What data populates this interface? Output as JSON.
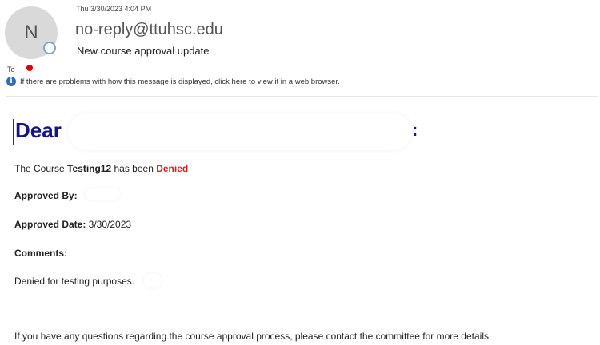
{
  "header": {
    "avatar_initial": "N",
    "timestamp": "Thu 3/30/2023 4:04 PM",
    "sender": "no-reply@ttuhsc.edu",
    "subject": "New course approval update",
    "to_label": "To",
    "info_text": "If there are problems with how this message is displayed, click here to view it in a web browser."
  },
  "body": {
    "greeting": "Dear",
    "greeting_colon": ":",
    "course_prefix": "The Course ",
    "course_name": "Testing12",
    "course_middle": " has been ",
    "course_status": "Denied",
    "approved_by_label": "Approved By:",
    "approved_date_label": "Approved Date:",
    "approved_date_value": " 3/30/2023",
    "comments_label": "Comments:",
    "comments_value": "Denied for testing purposes.",
    "footer_text": "If you have any questions regarding the course approval process, please contact the committee for more details."
  },
  "colors": {
    "greeting": "#141482",
    "status_denied": "#e01b1b",
    "info_icon": "#2f6db5",
    "recipient_dot": "#e00000"
  }
}
